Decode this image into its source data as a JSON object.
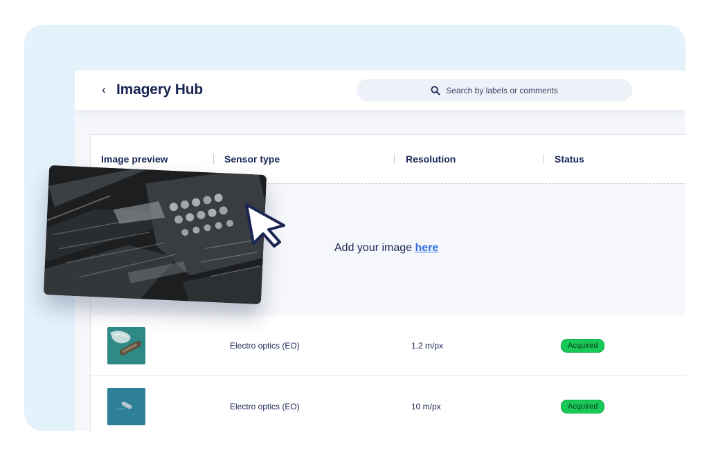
{
  "header": {
    "back_glyph": "‹",
    "title": "Imagery Hub",
    "search_placeholder": "Search by labels or comments"
  },
  "table": {
    "columns": [
      "Image preview",
      "Sensor type",
      "Resolution",
      "Status"
    ],
    "dropzone": {
      "text": "Add your image ",
      "link": "here"
    },
    "rows": [
      {
        "sensor": "Electro optics (EO)",
        "resolution": "1.2 m/px",
        "status": "Acquired"
      },
      {
        "sensor": "Electro optics (EO)",
        "resolution": "10 m/px",
        "status": "Acquired"
      }
    ]
  },
  "colors": {
    "accent": "#2f6fe4",
    "title": "#1a2553",
    "status_acquired": "#19c957",
    "background_panel": "#e4f2fb"
  },
  "icons": [
    "back-chevron-icon",
    "search-icon",
    "pointer-cursor-icon"
  ]
}
